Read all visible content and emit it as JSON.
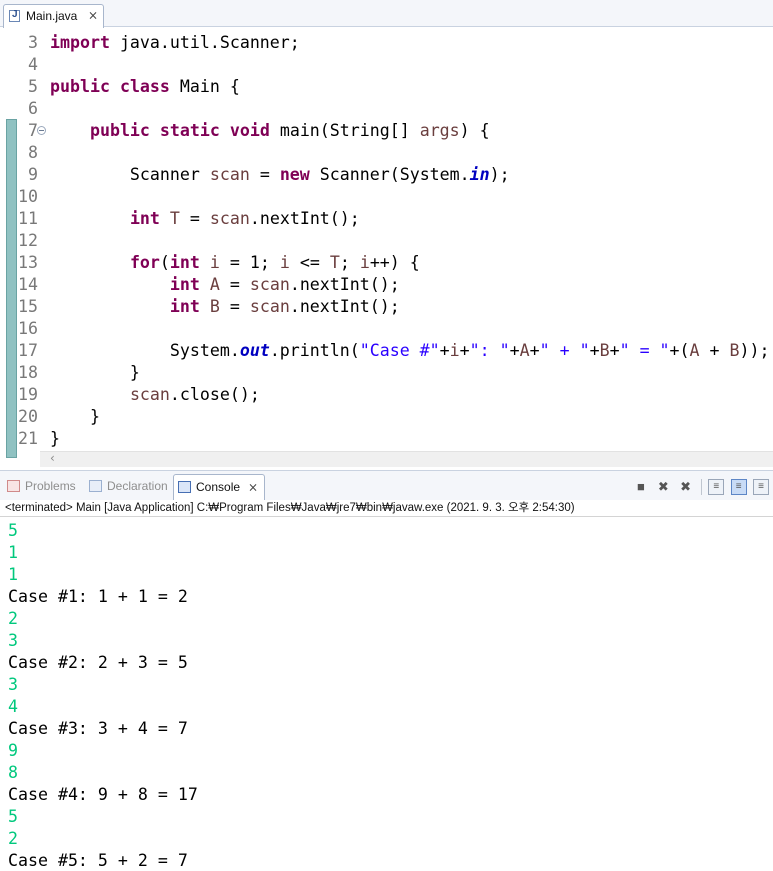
{
  "editor_tab": {
    "label": "Main.java",
    "close": "⨯"
  },
  "code_lines": [
    {
      "num": "3",
      "tokens": [
        {
          "t": "import",
          "c": "kw"
        },
        {
          "t": " java.util.Scanner;",
          "c": ""
        }
      ]
    },
    {
      "num": "4",
      "tokens": []
    },
    {
      "num": "5",
      "tokens": [
        {
          "t": "public",
          "c": "kw"
        },
        {
          "t": " ",
          "c": ""
        },
        {
          "t": "class",
          "c": "kw"
        },
        {
          "t": " Main {",
          "c": ""
        }
      ]
    },
    {
      "num": "6",
      "tokens": []
    },
    {
      "num": "7",
      "fold": true,
      "tokens": [
        {
          "t": "    ",
          "c": ""
        },
        {
          "t": "public",
          "c": "kw"
        },
        {
          "t": " ",
          "c": ""
        },
        {
          "t": "static",
          "c": "kw"
        },
        {
          "t": " ",
          "c": ""
        },
        {
          "t": "void",
          "c": "kw"
        },
        {
          "t": " main(String[] ",
          "c": ""
        },
        {
          "t": "args",
          "c": "var"
        },
        {
          "t": ") {",
          "c": ""
        }
      ]
    },
    {
      "num": "8",
      "tokens": []
    },
    {
      "num": "9",
      "tokens": [
        {
          "t": "        Scanner ",
          "c": ""
        },
        {
          "t": "scan",
          "c": "var"
        },
        {
          "t": " = ",
          "c": ""
        },
        {
          "t": "new",
          "c": "kw"
        },
        {
          "t": " Scanner(System.",
          "c": ""
        },
        {
          "t": "in",
          "c": "fld"
        },
        {
          "t": ");",
          "c": ""
        }
      ]
    },
    {
      "num": "10",
      "tokens": []
    },
    {
      "num": "11",
      "tokens": [
        {
          "t": "        ",
          "c": ""
        },
        {
          "t": "int",
          "c": "kw"
        },
        {
          "t": " ",
          "c": ""
        },
        {
          "t": "T",
          "c": "var"
        },
        {
          "t": " = ",
          "c": ""
        },
        {
          "t": "scan",
          "c": "var"
        },
        {
          "t": ".nextInt();",
          "c": ""
        }
      ]
    },
    {
      "num": "12",
      "tokens": []
    },
    {
      "num": "13",
      "tokens": [
        {
          "t": "        ",
          "c": ""
        },
        {
          "t": "for",
          "c": "kw"
        },
        {
          "t": "(",
          "c": ""
        },
        {
          "t": "int",
          "c": "kw"
        },
        {
          "t": " ",
          "c": ""
        },
        {
          "t": "i",
          "c": "var"
        },
        {
          "t": " = 1; ",
          "c": ""
        },
        {
          "t": "i",
          "c": "var"
        },
        {
          "t": " <= ",
          "c": ""
        },
        {
          "t": "T",
          "c": "var"
        },
        {
          "t": "; ",
          "c": ""
        },
        {
          "t": "i",
          "c": "var"
        },
        {
          "t": "++) {",
          "c": ""
        }
      ]
    },
    {
      "num": "14",
      "tokens": [
        {
          "t": "            ",
          "c": ""
        },
        {
          "t": "int",
          "c": "kw"
        },
        {
          "t": " ",
          "c": ""
        },
        {
          "t": "A",
          "c": "var"
        },
        {
          "t": " = ",
          "c": ""
        },
        {
          "t": "scan",
          "c": "var"
        },
        {
          "t": ".nextInt();",
          "c": ""
        }
      ]
    },
    {
      "num": "15",
      "tokens": [
        {
          "t": "            ",
          "c": ""
        },
        {
          "t": "int",
          "c": "kw"
        },
        {
          "t": " ",
          "c": ""
        },
        {
          "t": "B",
          "c": "var"
        },
        {
          "t": " = ",
          "c": ""
        },
        {
          "t": "scan",
          "c": "var"
        },
        {
          "t": ".nextInt();",
          "c": ""
        }
      ]
    },
    {
      "num": "16",
      "tokens": []
    },
    {
      "num": "17",
      "tokens": [
        {
          "t": "            System.",
          "c": ""
        },
        {
          "t": "out",
          "c": "fld"
        },
        {
          "t": ".println(",
          "c": ""
        },
        {
          "t": "\"Case #\"",
          "c": "str"
        },
        {
          "t": "+",
          "c": ""
        },
        {
          "t": "i",
          "c": "var"
        },
        {
          "t": "+",
          "c": ""
        },
        {
          "t": "\": \"",
          "c": "str"
        },
        {
          "t": "+",
          "c": ""
        },
        {
          "t": "A",
          "c": "var"
        },
        {
          "t": "+",
          "c": ""
        },
        {
          "t": "\" + \"",
          "c": "str"
        },
        {
          "t": "+",
          "c": ""
        },
        {
          "t": "B",
          "c": "var"
        },
        {
          "t": "+",
          "c": ""
        },
        {
          "t": "\" = \"",
          "c": "str"
        },
        {
          "t": "+(",
          "c": ""
        },
        {
          "t": "A",
          "c": "var"
        },
        {
          "t": " + ",
          "c": ""
        },
        {
          "t": "B",
          "c": "var"
        },
        {
          "t": "));",
          "c": ""
        }
      ]
    },
    {
      "num": "18",
      "tokens": [
        {
          "t": "        }",
          "c": ""
        }
      ]
    },
    {
      "num": "19",
      "tokens": [
        {
          "t": "        ",
          "c": ""
        },
        {
          "t": "scan",
          "c": "var"
        },
        {
          "t": ".close();",
          "c": ""
        }
      ]
    },
    {
      "num": "20",
      "tokens": [
        {
          "t": "    }",
          "c": ""
        }
      ]
    },
    {
      "num": "21",
      "tokens": [
        {
          "t": "}",
          "c": ""
        }
      ]
    }
  ],
  "view_tabs": [
    {
      "label": "Problems",
      "icon": "problems-icon",
      "active": false
    },
    {
      "label": "Declaration",
      "icon": "declaration-icon",
      "active": false
    },
    {
      "label": "Console",
      "icon": "console-icon",
      "active": true
    }
  ],
  "console": {
    "status": "<terminated> Main [Java Application] C:₩Program Files₩Java₩jre7₩bin₩javaw.exe (2021. 9. 3. 오후 2:54:30)",
    "lines": [
      {
        "text": "5",
        "kind": "in"
      },
      {
        "text": "1",
        "kind": "in"
      },
      {
        "text": "1",
        "kind": "in"
      },
      {
        "text": "Case #1: 1 + 1 = 2",
        "kind": "out"
      },
      {
        "text": "2",
        "kind": "in"
      },
      {
        "text": "3",
        "kind": "in"
      },
      {
        "text": "Case #2: 2 + 3 = 5",
        "kind": "out"
      },
      {
        "text": "3",
        "kind": "in"
      },
      {
        "text": "4",
        "kind": "in"
      },
      {
        "text": "Case #3: 3 + 4 = 7",
        "kind": "out"
      },
      {
        "text": "9",
        "kind": "in"
      },
      {
        "text": "8",
        "kind": "in"
      },
      {
        "text": "Case #4: 9 + 8 = 17",
        "kind": "out"
      },
      {
        "text": "5",
        "kind": "in"
      },
      {
        "text": "2",
        "kind": "in"
      },
      {
        "text": "Case #5: 5 + 2 = 7",
        "kind": "out"
      }
    ]
  },
  "colors": {
    "keyword": "#7f0055",
    "local_variable": "#6a3e3e",
    "string": "#2a00ff",
    "static_field": "#0000c0",
    "console_input": "#00c87d",
    "ruler_marker": "#90c2c2"
  }
}
